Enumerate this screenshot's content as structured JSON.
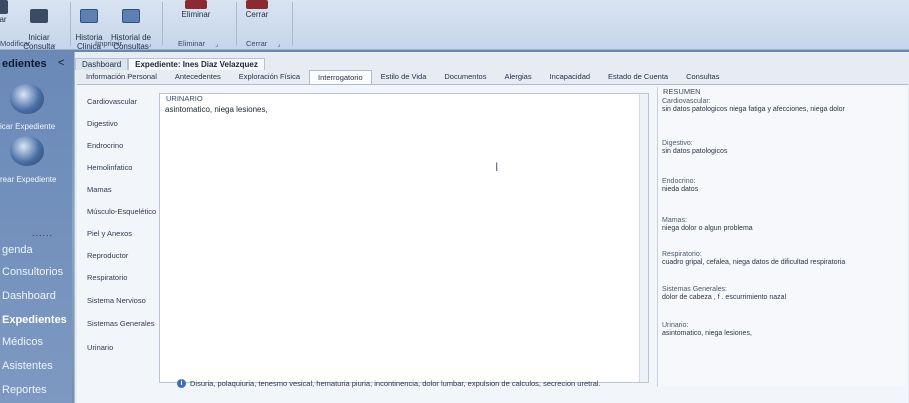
{
  "ribbon": {
    "buttons": [
      {
        "label": "Iniciar\nConsulta"
      },
      {
        "label": "Historia\nClinica"
      },
      {
        "label": "Historial de\nConsultas"
      },
      {
        "label": "Eliminar"
      },
      {
        "label": "Cerrar"
      }
    ],
    "groups": [
      "Modificar",
      "Imprimir",
      "Eliminar",
      "Cerrar"
    ],
    "left_cut": "ar"
  },
  "sidebar": {
    "title": "edientes",
    "collapse": "<",
    "actions": [
      "icar Expediente",
      "rear Expediente"
    ],
    "dots": "......",
    "items": [
      "genda",
      "Consultorios",
      "Dashboard",
      "Expedientes",
      "Médicos",
      "Asistentes",
      "Reportes"
    ]
  },
  "top_tabs": [
    "Dashboard",
    "Expediente: Ines Diaz Velazquez"
  ],
  "sub_tabs": [
    "Información Personal",
    "Antecedentes",
    "Exploración Física",
    "Interrogatorio",
    "Estilo de Vida",
    "Documentos",
    "Alergias",
    "Incapacidad",
    "Estado de Cuenta",
    "Consultas"
  ],
  "systems": [
    "Cardiovascular",
    "Digestivo",
    "Endrocrino",
    "Hemolinfatico",
    "Mamas",
    "Músculo-Esquelético",
    "Piel y Anexos",
    "Reproductor",
    "Respiratorio",
    "Sistema Nervioso",
    "Sistemas Generales",
    "Urinario"
  ],
  "urinario": {
    "legend": "URINARIO",
    "text": "asintomatico, niega lesiones,"
  },
  "resumen": {
    "title": "RESUMEN",
    "sections": [
      {
        "title": "Cardiovascular:",
        "text": "sin datos patologicos niega fatiga y afecciones, niega dolor"
      },
      {
        "title": "Digestivo:",
        "text": "sin datos patologicos"
      },
      {
        "title": "Endocrino:",
        "text": "nieda datos"
      },
      {
        "title": "Mamas:",
        "text": "niega dolor o algun problema"
      },
      {
        "title": "Respiratorio:",
        "text": "cuadro gripal, cefalea, niega datos de dificultad respiratoria"
      },
      {
        "title": "Sistemas Generales:",
        "text": "dolor de cabeza , f . escurrimiento nazal"
      },
      {
        "title": "Urinario:",
        "text": "asintomatico, niega lesiones,"
      }
    ]
  },
  "hint": "Disuria, polaquiuria, tenesmo vesical, hematuria piuria, incontinencia, dolor lumbar, expulsion de calculos, secrecion uretral."
}
